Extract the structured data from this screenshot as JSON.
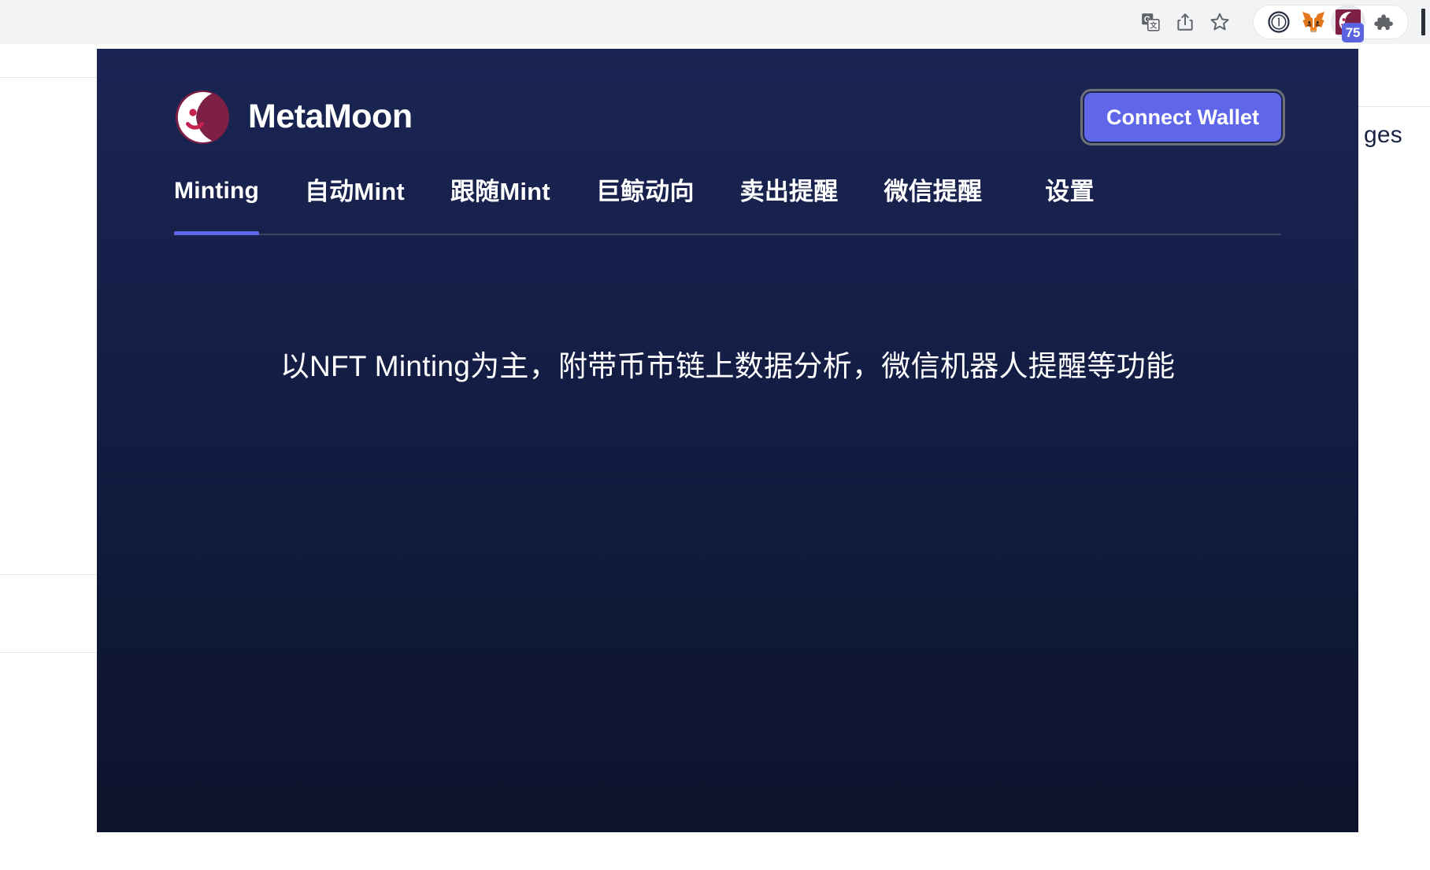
{
  "browser": {
    "toolbar_icons": [
      {
        "name": "google-translate-icon",
        "glyph": "translate"
      },
      {
        "name": "share-icon",
        "glyph": "share"
      },
      {
        "name": "bookmark-star-icon",
        "glyph": "star"
      }
    ],
    "extension_icons": [
      {
        "name": "onepassword-extension-icon",
        "glyph": "1password"
      },
      {
        "name": "metamask-extension-icon",
        "glyph": "metamask-fox"
      },
      {
        "name": "metamoon-extension-icon",
        "glyph": "metamoon-moon",
        "badge": "75"
      },
      {
        "name": "extensions-puzzle-icon",
        "glyph": "puzzle"
      }
    ],
    "badge_value": "75",
    "badge_color": "#5b63e0"
  },
  "background_page": {
    "visible_text_fragment": "ges"
  },
  "popup": {
    "brand": {
      "title": "MetaMoon",
      "logo_name": "metamoon-moon-logo",
      "logo_circle_color": "#7e2045",
      "logo_face_color": "#ffffff"
    },
    "connect_button": {
      "label": "Connect Wallet",
      "color": "#5f67e8",
      "focus_ring_color": "#6d7079"
    },
    "tabs": [
      {
        "label": "Minting",
        "active": true,
        "cjk": false
      },
      {
        "label": "自动Mint",
        "active": false,
        "cjk": true
      },
      {
        "label": "跟随Mint",
        "active": false,
        "cjk": true
      },
      {
        "label": "巨鲸动向",
        "active": false,
        "cjk": true
      },
      {
        "label": "卖出提醒",
        "active": false,
        "cjk": true
      },
      {
        "label": "微信提醒",
        "active": false,
        "cjk": true
      },
      {
        "label": "设置",
        "active": false,
        "cjk": true
      }
    ],
    "active_tab_indicator_color": "#5f67e8",
    "hero_text": "以NFT Minting为主，附带币市链上数据分析，微信机器人提醒等功能",
    "background_gradient_top": "#1b2553",
    "background_gradient_bottom": "#0c132c"
  }
}
